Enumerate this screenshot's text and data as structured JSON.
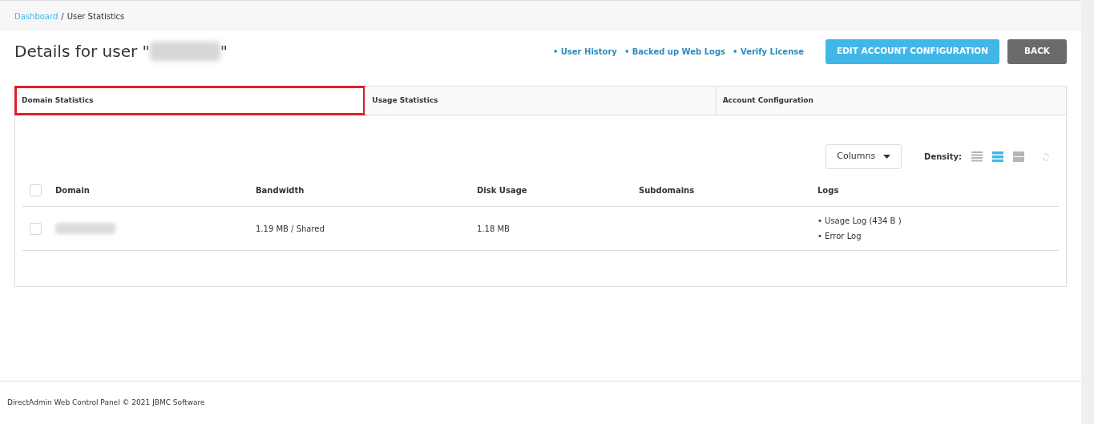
{
  "breadcrumb": {
    "link": "Dashboard",
    "separator": "/",
    "current": "User Statistics"
  },
  "title": {
    "prefix": "Details for user \"",
    "suffix": "\""
  },
  "links": [
    "• User History",
    "• Backed up Web Logs",
    "• Verify License"
  ],
  "buttons": [
    {
      "label": "EDIT ACCOUNT CONFIGURATION",
      "kind": "primary"
    },
    {
      "label": "BACK",
      "kind": "secondary"
    }
  ],
  "tabs": [
    {
      "label": "Domain Statistics",
      "highlighted": true
    },
    {
      "label": "Usage Statistics",
      "highlighted": false
    },
    {
      "label": "Account Configuration",
      "highlighted": false
    }
  ],
  "toolbar": {
    "columns_button": "Columns",
    "density_label": "Density:",
    "density": [
      {
        "kind": "compact",
        "selected": false
      },
      {
        "kind": "standard",
        "selected": true
      },
      {
        "kind": "comfortable",
        "selected": false
      }
    ]
  },
  "table": {
    "select_all": {
      "checked": false
    },
    "columns": [
      "Domain",
      "Bandwidth",
      "Disk Usage",
      "Subdomains",
      "Logs"
    ],
    "rows": [
      {
        "checked": false,
        "bandwidth": "1.19 MB / Shared",
        "disk_usage": "1.18 MB",
        "logs": [
          "• Usage Log (434 B )",
          "• Error Log"
        ]
      }
    ]
  },
  "footer": "DirectAdmin Web Control Panel © 2021 JBMC Software"
}
